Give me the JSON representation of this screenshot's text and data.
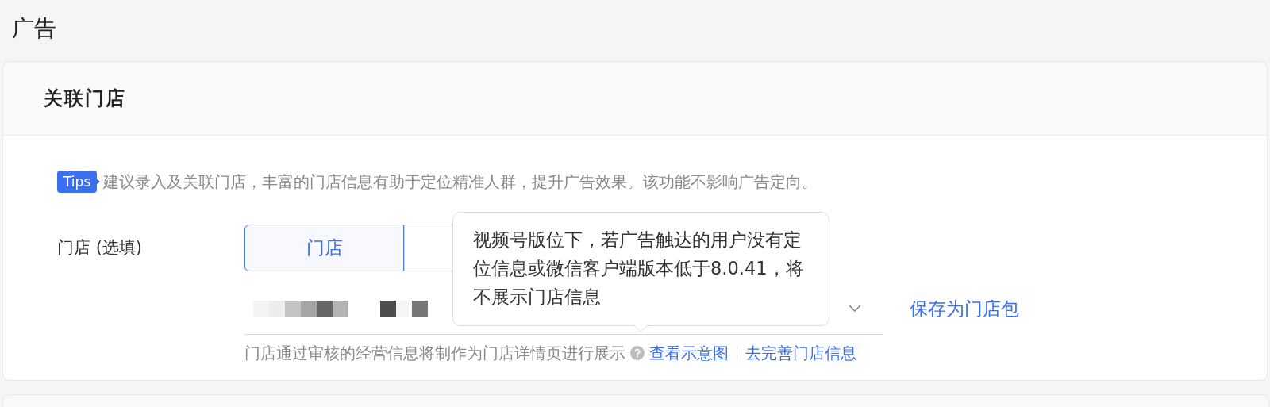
{
  "page": {
    "title": "广告"
  },
  "card": {
    "header": "关联门店",
    "tips": {
      "badge": "Tips",
      "text": "建议录入及关联门店，丰富的门店信息有助于定位精准人群，提升广告效果。该功能不影响广告定向。"
    },
    "form": {
      "label": "门店 (选填)",
      "segments": [
        {
          "label": "门店",
          "selected": true
        },
        {
          "selected": false
        }
      ],
      "save_link": "保存为门店包",
      "helper": {
        "text": "门店通过审核的经营信息将制作为门店详情页进行展示",
        "links": [
          "查看示意图",
          "去完善门店信息"
        ]
      },
      "tooltip": {
        "text": "视频号版位下，若广告触达的用户没有定位信息或微信客户端版本低于8.0.41，将不展示门店信息"
      }
    }
  }
}
